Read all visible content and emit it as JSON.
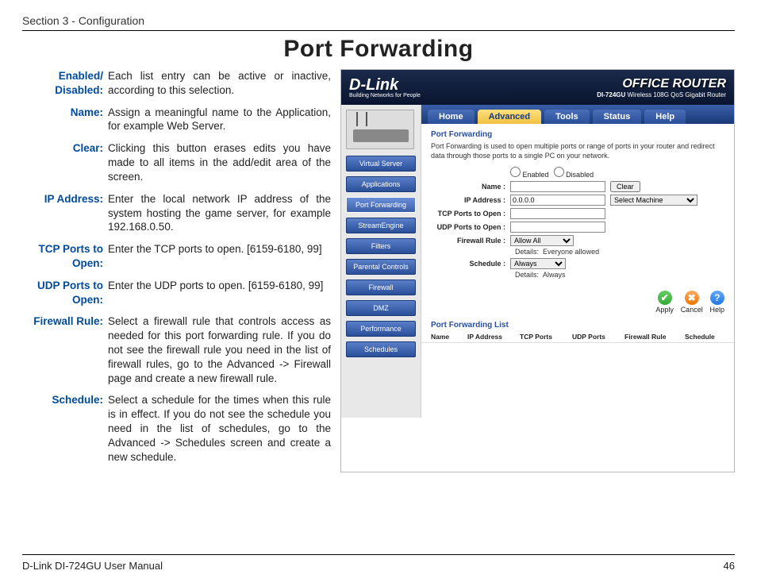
{
  "header": {
    "section": "Section 3 - Configuration"
  },
  "title": "Port Forwarding",
  "definitions": [
    {
      "label": "Enabled/ Disabled:",
      "text": "Each list entry can be active or inactive, according to this selection."
    },
    {
      "label": "Name:",
      "text": "Assign a meaningful name to the Application, for example Web Server."
    },
    {
      "label": "Clear:",
      "text": "Clicking this button erases edits you have made to all items in the add/edit area of the screen."
    },
    {
      "label": "IP Address:",
      "text": "Enter the local network IP address of the system hosting the game server, for example 192.168.0.50."
    },
    {
      "label": "TCP Ports to Open:",
      "text": "Enter the TCP ports to open. [6159-6180, 99]"
    },
    {
      "label": "UDP Ports to Open:",
      "text": "Enter the UDP ports to open. [6159-6180, 99]"
    },
    {
      "label": "Firewall Rule:",
      "text": "Select a firewall rule that controls access as needed for this port forwarding rule. If you do not see the firewall rule you need in the list of firewall rules, go to the Advanced -> Firewall page and create a new firewall rule."
    },
    {
      "label": "Schedule:",
      "text": "Select a schedule for the times when this rule is in effect. If you do not see the schedule you need in the list of schedules, go to the Advanced -> Schedules screen and create a new schedule."
    }
  ],
  "router": {
    "brand": "D-Link",
    "brand_sub": "Building Networks for People",
    "product_title": "OFFICE ROUTER",
    "product_model": "DI-724GU",
    "product_desc": "Wireless 108G QoS Gigabit Router",
    "tabs": [
      "Home",
      "Advanced",
      "Tools",
      "Status",
      "Help"
    ],
    "active_tab": 1,
    "sidenav": [
      "Virtual Server",
      "Applications",
      "Port Forwarding",
      "StreamEngine",
      "Filters",
      "Parental Controls",
      "Firewall",
      "DMZ",
      "Performance",
      "Schedules"
    ],
    "active_side": 2,
    "panel": {
      "title": "Port Forwarding",
      "desc": "Port Forwarding is used to open multiple ports or range of ports in your router and redirect data through those ports to a single PC on your network.",
      "enabled_label": "Enabled",
      "disabled_label": "Disabled",
      "name_label": "Name :",
      "name_value": "",
      "clear_btn": "Clear",
      "ip_label": "IP Address :",
      "ip_value": "0.0.0.0",
      "machine_select": "Select Machine",
      "tcp_label": "TCP Ports to Open :",
      "tcp_value": "",
      "udp_label": "UDP Ports to Open :",
      "udp_value": "",
      "fw_label": "Firewall Rule :",
      "fw_value": "Allow All",
      "fw_details_label": "Details:",
      "fw_details": "Everyone allowed",
      "sched_label": "Schedule :",
      "sched_value": "Always",
      "sched_details_label": "Details:",
      "sched_details": "Always"
    },
    "actions": {
      "apply": "Apply",
      "cancel": "Cancel",
      "help": "Help"
    },
    "list": {
      "title": "Port Forwarding List",
      "cols": [
        "Name",
        "IP Address",
        "TCP Ports",
        "UDP Ports",
        "Firewall Rule",
        "Schedule"
      ]
    }
  },
  "footer": {
    "left": "D-Link DI-724GU User Manual",
    "page": "46"
  }
}
